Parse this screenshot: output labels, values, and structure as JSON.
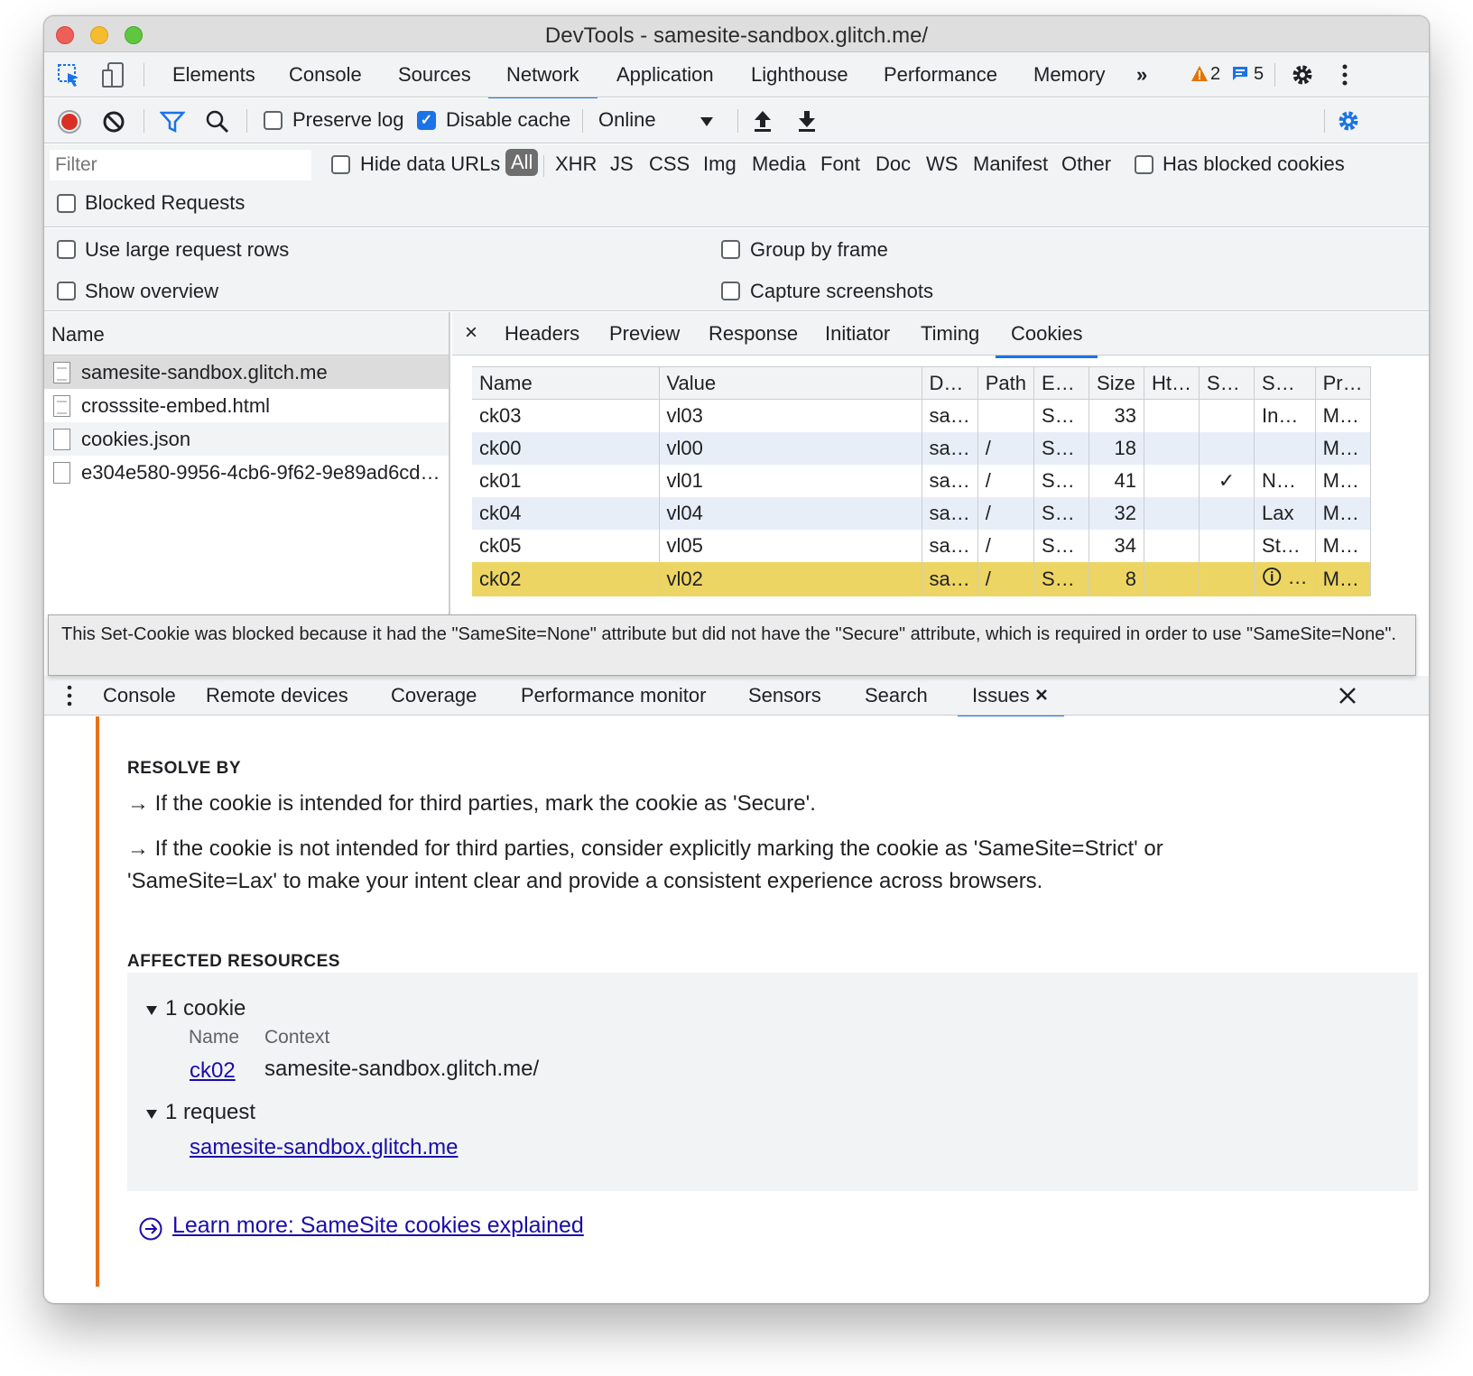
{
  "window": {
    "title": "DevTools - samesite-sandbox.glitch.me/"
  },
  "main_tabs": [
    "Elements",
    "Console",
    "Sources",
    "Network",
    "Application",
    "Lighthouse",
    "Performance",
    "Memory"
  ],
  "main_active": "Network",
  "more_tabs": "»",
  "badges": {
    "warnings": "2",
    "messages": "5",
    "warning_color": "#e37400",
    "message_color": "#1a73e8"
  },
  "toolbar": {
    "preserve_log": "Preserve log",
    "disable_cache": "Disable cache",
    "disable_cache_checked": true,
    "preserve_log_checked": false,
    "throttle": "Online"
  },
  "filter": {
    "placeholder": "Filter",
    "hide_data_urls": "Hide data URLs",
    "types": [
      "All",
      "XHR",
      "JS",
      "CSS",
      "Img",
      "Media",
      "Font",
      "Doc",
      "WS",
      "Manifest",
      "Other"
    ],
    "has_blocked_cookies": "Has blocked cookies",
    "blocked_requests": "Blocked Requests"
  },
  "settings": {
    "large_rows": "Use large request rows",
    "group_by_frame": "Group by frame",
    "show_overview": "Show overview",
    "capture_screenshots": "Capture screenshots"
  },
  "request_list": {
    "header": "Name",
    "rows": [
      "samesite-sandbox.glitch.me",
      "crosssite-embed.html",
      "cookies.json",
      "e304e580-9956-4cb6-9f62-9e89ad6cd…"
    ]
  },
  "detail_tabs": [
    "Headers",
    "Preview",
    "Response",
    "Initiator",
    "Timing",
    "Cookies"
  ],
  "detail_active": "Cookies",
  "detail_close": "×",
  "cookies": {
    "columns": [
      "Name",
      "Value",
      "D…",
      "Path",
      "E…",
      "Size",
      "Ht…",
      "S…",
      "S…",
      "Pr…"
    ],
    "rows": [
      [
        "ck03",
        "vl03",
        "sa…",
        "",
        "S…",
        "33",
        "",
        "",
        "In…",
        "M…"
      ],
      [
        "ck00",
        "vl00",
        "sa…",
        "/",
        "S…",
        "18",
        "",
        "",
        "",
        "M…"
      ],
      [
        "ck01",
        "vl01",
        "sa…",
        "/",
        "S…",
        "41",
        "",
        "✓",
        "N…",
        "M…"
      ],
      [
        "ck04",
        "vl04",
        "sa…",
        "/",
        "S…",
        "32",
        "",
        "",
        "Lax",
        "M…"
      ],
      [
        "ck05",
        "vl05",
        "sa…",
        "/",
        "S…",
        "34",
        "",
        "",
        "St…",
        "M…"
      ],
      [
        "ck02",
        "vl02",
        "sa…",
        "/",
        "S…",
        "8",
        "",
        "",
        "🛈 …",
        "M…"
      ]
    ],
    "blocked_color": "#edd564"
  },
  "tooltip": "This Set-Cookie was blocked because it had the \"SameSite=None\" attribute but did not have the \"Secure\" attribute, which is required in order to use \"SameSite=None\".",
  "drawer_tabs": [
    "Console",
    "Remote devices",
    "Coverage",
    "Performance monitor",
    "Sensors",
    "Search",
    "Issues"
  ],
  "drawer_active": "Issues",
  "issues": {
    "resolve_heading": "RESOLVE BY",
    "resolve_1": "→ If the cookie is intended for third parties, mark the cookie as 'Secure'.",
    "resolve_2a": "→ If the cookie is not intended for third parties, consider explicitly marking the cookie as 'SameSite=Strict' or",
    "resolve_2b": "'SameSite=Lax' to make your intent clear and provide a consistent experience across browsers.",
    "affected_heading": "AFFECTED RESOURCES",
    "cookie_group": "1 cookie",
    "col_name": "Name",
    "col_context": "Context",
    "cookie_name": "ck02",
    "cookie_context": "samesite-sandbox.glitch.me/",
    "request_group": "1 request",
    "request_link": "samesite-sandbox.glitch.me",
    "learn_more": "Learn more: SameSite cookies explained",
    "accent_color": "#e8711c"
  }
}
